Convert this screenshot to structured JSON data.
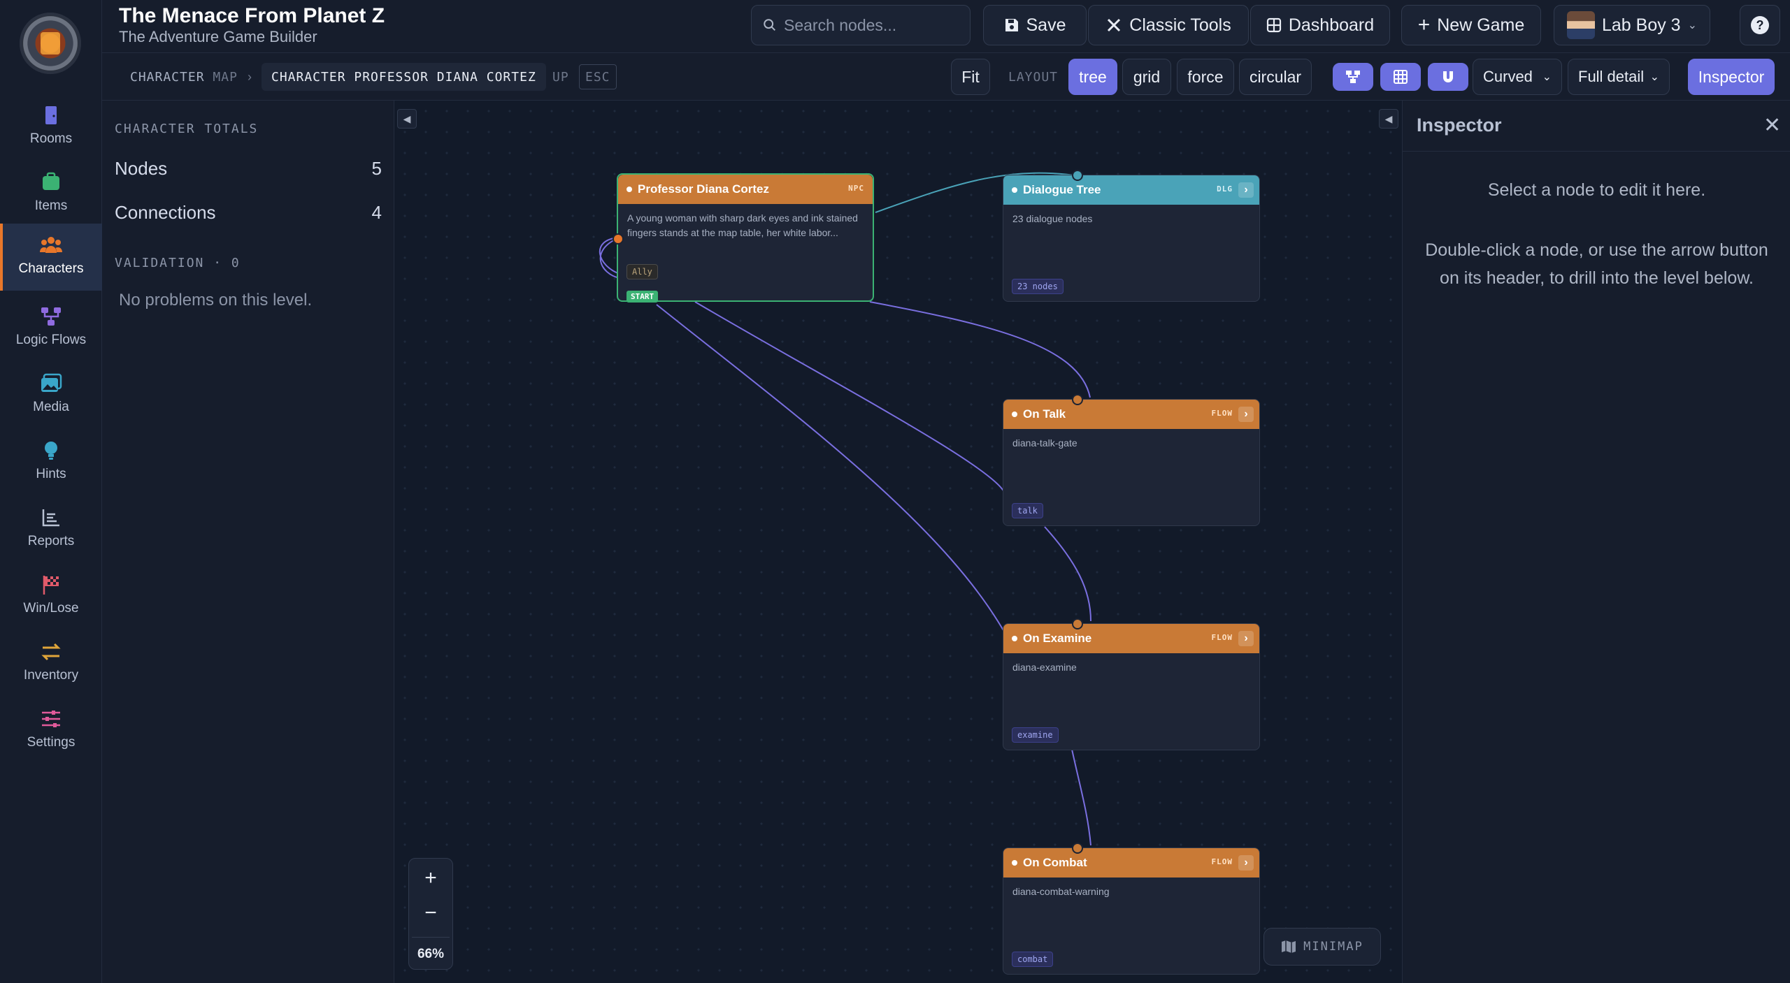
{
  "app": {
    "title": "The Menace From Planet Z",
    "subtitle": "The Adventure Game Builder"
  },
  "nav": {
    "items": [
      {
        "label": "Rooms",
        "icon": "door-icon",
        "color": "#6b6fe0"
      },
      {
        "label": "Items",
        "icon": "bag-icon",
        "color": "#3bb273"
      },
      {
        "label": "Characters",
        "icon": "people-icon",
        "color": "#e8772a",
        "active": true
      },
      {
        "label": "Logic Flows",
        "icon": "flow-icon",
        "color": "#8f6be0"
      },
      {
        "label": "Media",
        "icon": "image-icon",
        "color": "#3aa6c9"
      },
      {
        "label": "Hints",
        "icon": "bulb-icon",
        "color": "#3aa6c9"
      },
      {
        "label": "Reports",
        "icon": "chart-icon",
        "color": "#b8c1d3"
      },
      {
        "label": "Win/Lose",
        "icon": "flag-icon",
        "color": "#e05a6a"
      },
      {
        "label": "Inventory",
        "icon": "swap-icon",
        "color": "#e0a53a"
      },
      {
        "label": "Settings",
        "icon": "sliders-icon",
        "color": "#e05a9a"
      }
    ]
  },
  "toolbar": {
    "search_placeholder": "Search nodes...",
    "save": "Save",
    "classic_tools": "Classic Tools",
    "dashboard": "Dashboard",
    "new_game": "New Game",
    "user": "Lab Boy 3",
    "help": "?"
  },
  "breadcrumb": {
    "root_a": "CHARACTER",
    "root_b": "MAP",
    "sep": "›",
    "current": "CHARACTER PROFESSOR DIANA CORTEZ",
    "up": "UP",
    "esc": "ESC"
  },
  "controls": {
    "fit": "Fit",
    "layout_label": "LAYOUT",
    "layouts": [
      "tree",
      "grid",
      "force",
      "circular"
    ],
    "active_layout": "tree",
    "edge_style": "Curved",
    "detail": "Full detail",
    "inspector": "Inspector"
  },
  "left_panel": {
    "totals_title": "CHARACTER TOTALS",
    "nodes_label": "Nodes",
    "nodes_value": "5",
    "connections_label": "Connections",
    "connections_value": "4",
    "validation_title": "VALIDATION · 0",
    "validation_message": "No problems on this level."
  },
  "nodes": {
    "diana": {
      "title": "Professor Diana Cortez",
      "type": "NPC",
      "body": "A young woman with sharp dark eyes and ink stained fingers stands at the map table, her white labor...",
      "tag": "Ally",
      "start": "START",
      "color": "#c97a36"
    },
    "dialogue": {
      "title": "Dialogue Tree",
      "type": "DLG",
      "body": "23 dialogue nodes",
      "tag": "23 nodes",
      "color": "#4aa3b8"
    },
    "talk": {
      "title": "On Talk",
      "type": "FLOW",
      "body": "diana-talk-gate",
      "tag": "talk",
      "color": "#c97a36"
    },
    "examine": {
      "title": "On Examine",
      "type": "FLOW",
      "body": "diana-examine",
      "tag": "examine",
      "color": "#c97a36"
    },
    "combat": {
      "title": "On Combat",
      "type": "FLOW",
      "body": "diana-combat-warning",
      "tag": "combat",
      "color": "#c97a36"
    }
  },
  "zoom": {
    "plus": "+",
    "minus": "−",
    "level": "66%"
  },
  "minimap": {
    "label": "MINIMAP"
  },
  "inspector": {
    "title": "Inspector",
    "line1": "Select a node to edit it here.",
    "line2": "Double-click a node, or use the arrow button on its header, to drill into the level below."
  }
}
